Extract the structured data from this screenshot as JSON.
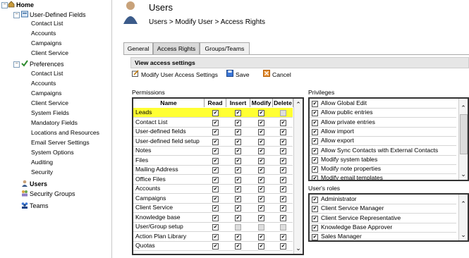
{
  "tree": {
    "home": "Home",
    "udf": "User-Defined Fields",
    "udf_items": [
      "Contact List",
      "Accounts",
      "Campaigns",
      "Client Service"
    ],
    "prefs": "Preferences",
    "pref_items": [
      "Contact List",
      "Accounts",
      "Campaigns",
      "Client Service",
      "System Fields",
      "Mandatory Fields",
      "Locations and Resources",
      "Email Server Settings",
      "System Options",
      "Auditing",
      "Security"
    ],
    "users": "Users",
    "security_groups": "Security Groups",
    "teams": "Teams"
  },
  "header": {
    "title": "Users",
    "breadcrumb": "Users > Modify User > Access Rights"
  },
  "tabs": [
    "General",
    "Access Rights",
    "Groups/Teams"
  ],
  "panel": {
    "title": "View access settings"
  },
  "toolbar": {
    "modify": "Modify User Access Settings",
    "save": "Save",
    "cancel": "Cancel"
  },
  "permissions": {
    "label": "Permissions",
    "columns": [
      "Name",
      "Read",
      "Insert",
      "Modify",
      "Delete"
    ],
    "rows": [
      {
        "name": "Leads",
        "checks": [
          1,
          1,
          1,
          2
        ]
      },
      {
        "name": "Contact List",
        "checks": [
          1,
          1,
          1,
          1
        ]
      },
      {
        "name": "User-defined fields",
        "checks": [
          1,
          1,
          1,
          1
        ]
      },
      {
        "name": "User-defined field setup",
        "checks": [
          1,
          1,
          1,
          1
        ]
      },
      {
        "name": "Notes",
        "checks": [
          1,
          1,
          1,
          1
        ]
      },
      {
        "name": "Files",
        "checks": [
          1,
          1,
          1,
          1
        ]
      },
      {
        "name": "Mailing Address",
        "checks": [
          1,
          1,
          1,
          1
        ]
      },
      {
        "name": "Office Files",
        "checks": [
          1,
          1,
          1,
          1
        ]
      },
      {
        "name": "Accounts",
        "checks": [
          1,
          1,
          1,
          1
        ]
      },
      {
        "name": "Campaigns",
        "checks": [
          1,
          1,
          1,
          1
        ]
      },
      {
        "name": "Client Service",
        "checks": [
          1,
          1,
          1,
          1
        ]
      },
      {
        "name": "Knowledge base",
        "checks": [
          1,
          1,
          1,
          1
        ]
      },
      {
        "name": "User/Group setup",
        "checks": [
          1,
          2,
          2,
          2
        ]
      },
      {
        "name": "Action Plan Library",
        "checks": [
          1,
          1,
          1,
          1
        ]
      },
      {
        "name": "Quotas",
        "checks": [
          1,
          1,
          1,
          1
        ]
      }
    ]
  },
  "privileges": {
    "label": "Privileges",
    "items": [
      "Allow Global Edit",
      "Allow public entries",
      "Allow private entries",
      "Allow import",
      "Allow export",
      "Allow Sync Contacts with External Contacts",
      "Modify system tables",
      "Modify note properties",
      "Modify email templates"
    ]
  },
  "roles": {
    "label": "User's roles",
    "items": [
      "Administrator",
      "Client Service Manager",
      "Client Service Representative",
      "Knowledge Base Approver",
      "Sales Manager"
    ]
  },
  "colors": {
    "highlight": "#ffff33",
    "tab_active": "#d9d9d9"
  }
}
